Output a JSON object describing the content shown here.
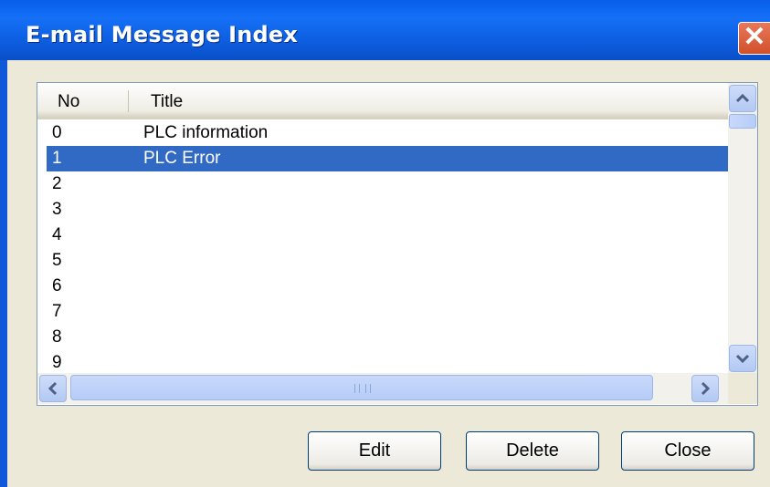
{
  "window": {
    "title": "E-mail Message Index",
    "close_glyph": "✕"
  },
  "list": {
    "columns": [
      "No",
      "Title"
    ],
    "rows": [
      {
        "no": "0",
        "title": "PLC information"
      },
      {
        "no": "1",
        "title": "PLC Error",
        "selected": true
      },
      {
        "no": "2",
        "title": ""
      },
      {
        "no": "3",
        "title": ""
      },
      {
        "no": "4",
        "title": ""
      },
      {
        "no": "5",
        "title": ""
      },
      {
        "no": "6",
        "title": ""
      },
      {
        "no": "7",
        "title": ""
      },
      {
        "no": "8",
        "title": ""
      },
      {
        "no": "9",
        "title": ""
      }
    ]
  },
  "buttons": {
    "edit": "Edit",
    "delete": "Delete",
    "close": "Close"
  },
  "colors": {
    "titlebar": "#0b64f0",
    "selection": "#316ac5",
    "face": "#ece9d8"
  }
}
